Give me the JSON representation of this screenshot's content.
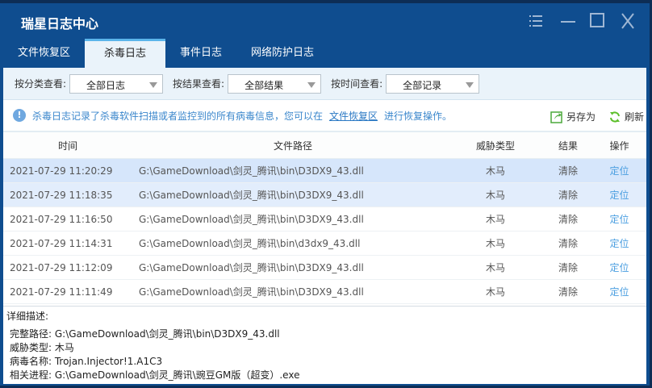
{
  "window": {
    "title": "瑞星日志中心"
  },
  "tabs": [
    {
      "label": "文件恢复区"
    },
    {
      "label": "杀毒日志"
    },
    {
      "label": "事件日志"
    },
    {
      "label": "网络防护日志"
    }
  ],
  "filters": [
    {
      "label": "按分类查看:",
      "value": "全部日志"
    },
    {
      "label": "按结果查看:",
      "value": "全部结果"
    },
    {
      "label": "按时间查看:",
      "value": "全部记录"
    }
  ],
  "info": {
    "message": "杀毒日志记录了杀毒软件扫描或者监控到的所有病毒信息，您可以在",
    "link": "文件恢复区",
    "suffix": "进行恢复操作。",
    "save_as": "另存为",
    "refresh": "刷新"
  },
  "table": {
    "headers": [
      "时间",
      "文件路径",
      "威胁类型",
      "结果",
      "操作"
    ],
    "rows": [
      [
        "2021-07-29 11:20:29",
        "G:\\GameDownload\\剑灵_腾讯\\bin\\D3DX9_43.dll",
        "木马",
        "清除",
        "定位"
      ],
      [
        "2021-07-29 11:18:35",
        "G:\\GameDownload\\剑灵_腾讯\\bin\\D3DX9_43.dll",
        "木马",
        "清除",
        "定位"
      ],
      [
        "2021-07-29 11:16:50",
        "G:\\GameDownload\\剑灵_腾讯\\bin\\D3DX9_43.dll",
        "木马",
        "清除",
        "定位"
      ],
      [
        "2021-07-29 11:14:31",
        "G:\\GameDownload\\剑灵_腾讯\\bin\\d3dx9_43.dll",
        "木马",
        "清除",
        "定位"
      ],
      [
        "2021-07-29 11:12:09",
        "G:\\GameDownload\\剑灵_腾讯\\bin\\D3DX9_43.dll",
        "木马",
        "清除",
        "定位"
      ],
      [
        "2021-07-29 11:11:49",
        "G:\\GameDownload\\剑灵_腾讯\\bin\\D3DX9_43.dll",
        "木马",
        "清除",
        "定位"
      ]
    ]
  },
  "detail": {
    "heading": "详细描述:",
    "lines": [
      "完整路径: G:\\GameDownload\\剑灵_腾讯\\bin\\D3DX9_43.dll",
      "威胁类型: 木马",
      "病毒名称: Trojan.Injector!1.A1C3",
      "相关进程: G:\\GameDownload\\剑灵_腾讯\\豌豆GM版（超变）.exe"
    ]
  }
}
